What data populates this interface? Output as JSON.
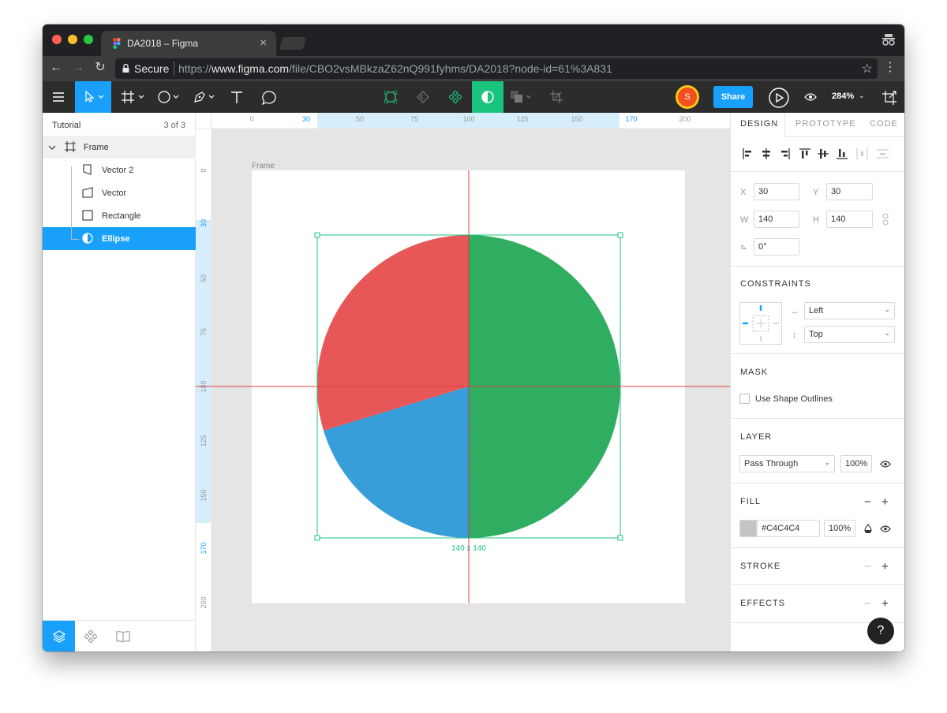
{
  "browser": {
    "tab_title": "DA2018 – Figma",
    "tab_close": "×",
    "secure_label": "Secure",
    "url_scheme": "https://",
    "url_host": "www.figma.com",
    "url_path": "/file/CBO2vsMBkzaZ62nQ991fyhms/DA2018?node-id=61%3A831"
  },
  "toolbar": {
    "avatar_initial": "S",
    "share_label": "Share",
    "zoom_level": "284%"
  },
  "layers": {
    "page_name": "Tutorial",
    "page_count": "3 of 3",
    "items": [
      {
        "label": "Frame",
        "icon": "frame-icon"
      },
      {
        "label": "Vector 2",
        "icon": "vector-icon"
      },
      {
        "label": "Vector",
        "icon": "vector-icon"
      },
      {
        "label": "Rectangle",
        "icon": "rectangle-icon"
      },
      {
        "label": "Ellipse",
        "icon": "ellipse-icon",
        "selected": true
      }
    ]
  },
  "canvas": {
    "frame_label": "Frame",
    "size_label": "140 x 140",
    "ruler_top": [
      "0",
      "30",
      "50",
      "75",
      "100",
      "125",
      "150",
      "170",
      "200"
    ],
    "ruler_left": [
      "0",
      "30",
      "50",
      "75",
      "100",
      "125",
      "150",
      "170",
      "200"
    ],
    "colors": {
      "red": "#e85757",
      "green": "#2fae62",
      "blue": "#389ed9",
      "selection": "#1bc47d",
      "guide": "#e0413a",
      "ruler_highlight": "#d6eefc",
      "ruler_highlight_text": "#18a0fb"
    }
  },
  "props": {
    "tabs": [
      "DESIGN",
      "PROTOTYPE",
      "CODE"
    ],
    "x_label": "X",
    "x_value": "30",
    "y_label": "Y",
    "y_value": "30",
    "w_label": "W",
    "w_value": "140",
    "h_label": "H",
    "h_value": "140",
    "rotation_label": "⊾",
    "rotation_value": "0°",
    "constraints_title": "CONSTRAINTS",
    "constraint_h": "Left",
    "constraint_v": "Top",
    "mask_title": "MASK",
    "mask_option": "Use Shape Outlines",
    "layer_title": "LAYER",
    "blend_mode": "Pass Through",
    "layer_opacity": "100%",
    "fill_title": "FILL",
    "fill_color": "#C4C4C4",
    "fill_opacity": "100%",
    "stroke_title": "STROKE",
    "effects_title": "EFFECTS",
    "minus": "−",
    "plus": "+",
    "help": "?"
  }
}
